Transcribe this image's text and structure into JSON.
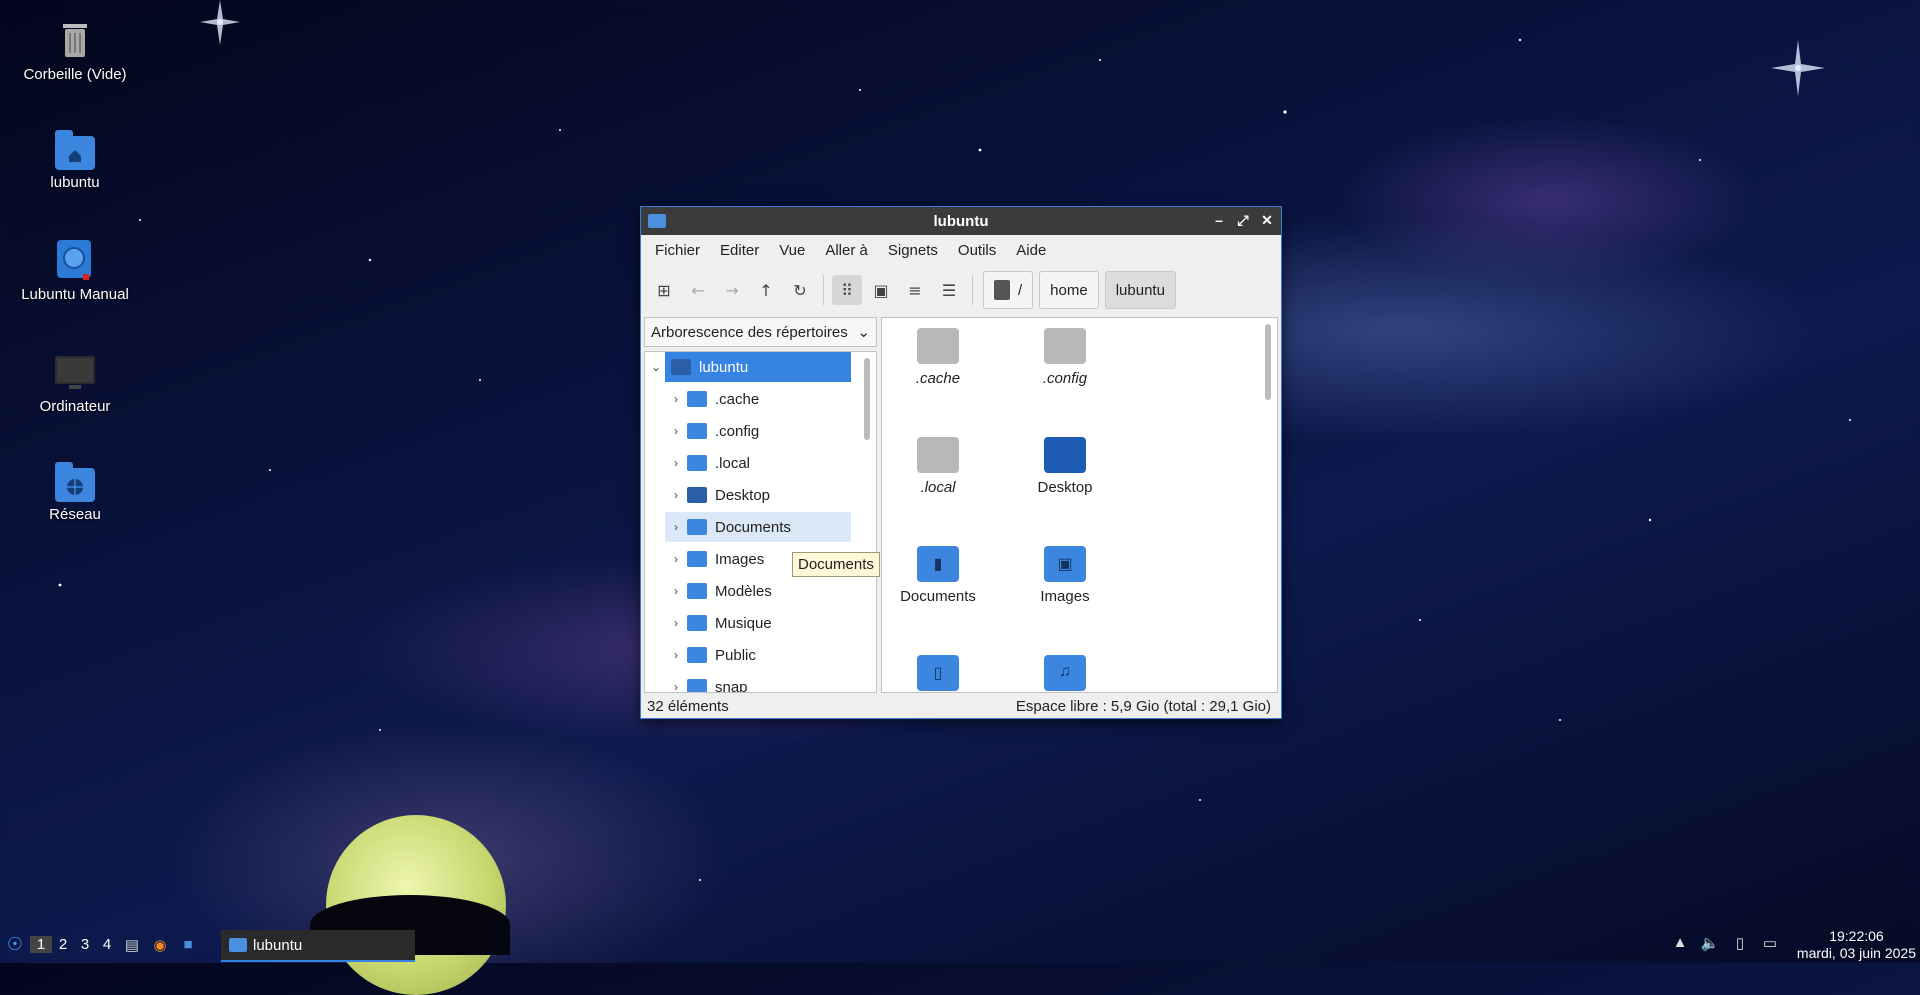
{
  "desktop": {
    "icons": [
      {
        "label": "Corbeille (Vide)",
        "icon": "trash-icon"
      },
      {
        "label": "lubuntu",
        "icon": "home-folder-icon"
      },
      {
        "label": "Lubuntu Manual",
        "icon": "manual-icon"
      },
      {
        "label": "Ordinateur",
        "icon": "computer-icon"
      },
      {
        "label": "Réseau",
        "icon": "network-icon"
      }
    ]
  },
  "window": {
    "title": "lubuntu",
    "menu": [
      "Fichier",
      "Editer",
      "Vue",
      "Aller à",
      "Signets",
      "Outils",
      "Aide"
    ],
    "breadcrumb": {
      "root": "/",
      "parts": [
        "home",
        "lubuntu"
      ]
    },
    "side_pane_mode": "Arborescence des répertoires",
    "tree": [
      {
        "label": "lubuntu",
        "icon": "home-folder-icon"
      },
      {
        "label": ".cache",
        "icon": "folder-icon"
      },
      {
        "label": ".config",
        "icon": "folder-icon"
      },
      {
        "label": ".local",
        "icon": "folder-icon"
      },
      {
        "label": "Desktop",
        "icon": "desktop-folder-icon"
      },
      {
        "label": "Documents",
        "icon": "documents-folder-icon"
      },
      {
        "label": "Images",
        "icon": "pictures-folder-icon"
      },
      {
        "label": "Modèles",
        "icon": "templates-folder-icon"
      },
      {
        "label": "Musique",
        "icon": "music-folder-icon"
      },
      {
        "label": "Public",
        "icon": "public-folder-icon"
      },
      {
        "label": "snap",
        "icon": "folder-icon"
      }
    ],
    "files": [
      {
        "label": ".cache",
        "hidden": true,
        "icon": "folder-icon"
      },
      {
        "label": ".config",
        "hidden": true,
        "icon": "folder-icon"
      },
      {
        "label": ".local",
        "hidden": true,
        "icon": "folder-icon"
      },
      {
        "label": "Desktop",
        "hidden": false,
        "icon": "desktop-folder-icon"
      },
      {
        "label": "Documents",
        "hidden": false,
        "icon": "documents-folder-icon"
      },
      {
        "label": "Images",
        "hidden": false,
        "icon": "pictures-folder-icon"
      },
      {
        "label": "",
        "hidden": false,
        "icon": "templates-folder-icon"
      },
      {
        "label": "",
        "hidden": false,
        "icon": "music-folder-icon"
      }
    ],
    "tooltip": "Documents",
    "status": {
      "count": "32 éléments",
      "free": "Espace libre : 5,9 Gio (total : 29,1 Gio)"
    }
  },
  "taskbar": {
    "workspaces": [
      "1",
      "2",
      "3",
      "4"
    ],
    "task_label": "lubuntu",
    "time": "19:22:06",
    "date": "mardi, 03 juin 2025"
  }
}
